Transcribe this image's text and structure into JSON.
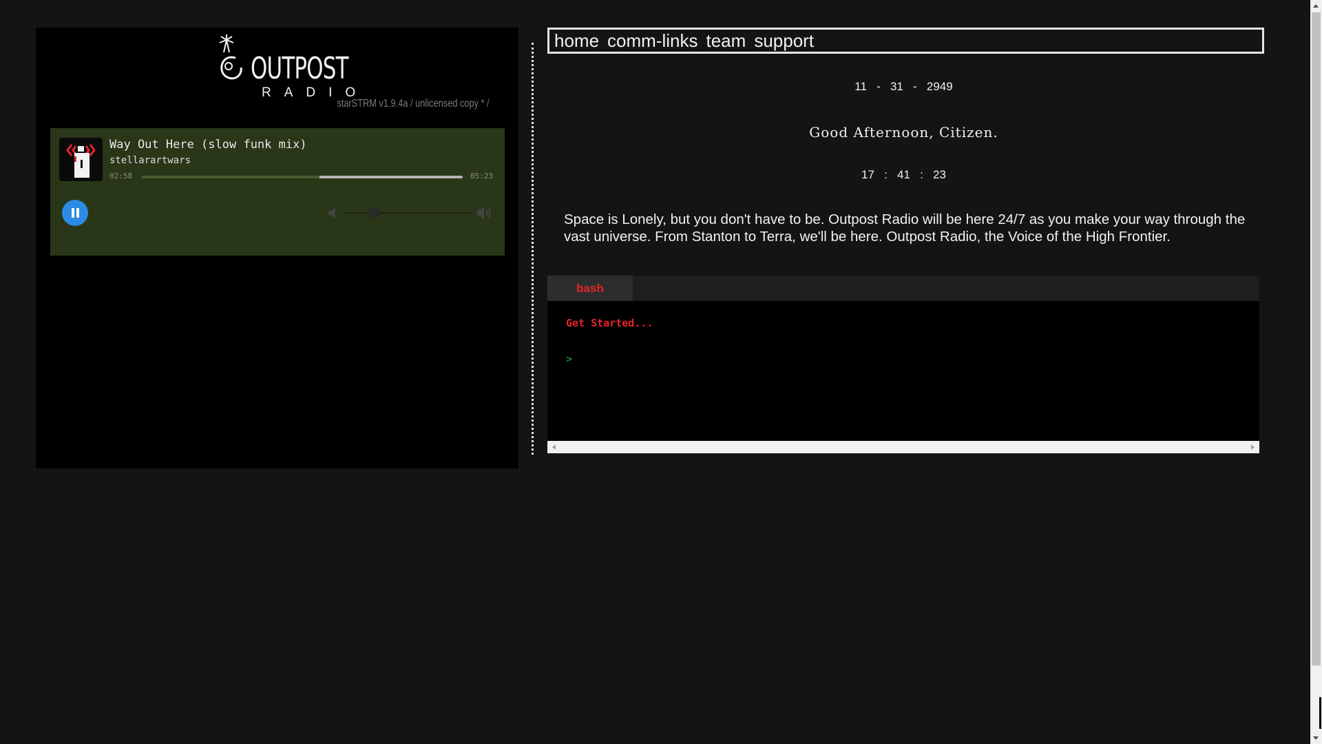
{
  "player": {
    "logo_word": "OUTPOST",
    "logo_sub": "RADIO",
    "version": "starSTRM v1.9.4a / unlicensed copy * /",
    "track_title": "Way Out Here (slow funk mix)",
    "artist": "stellarartwars",
    "time_elapsed": "02:58",
    "time_total": "05:23",
    "progress_fraction": 0.553,
    "volume_fraction": 0.23,
    "icons": {
      "album_art": "outpost-radio-tower-icon",
      "pause": "pause-icon",
      "volume_low": "volume-low-icon",
      "volume_high": "volume-high-icon"
    },
    "colors": {
      "panel_bg": "#000000",
      "player_bg": "#2a3618",
      "play_button": "#2d8be6"
    }
  },
  "nav": {
    "items": [
      "home",
      "comm-links",
      "team",
      "support"
    ]
  },
  "date": {
    "month": "11",
    "day": "31",
    "year": "2949",
    "separator": "-"
  },
  "greeting": "Good Afternoon, Citizen.",
  "clock": {
    "hours": "17",
    "minutes": "41",
    "seconds": "23",
    "separator": ":"
  },
  "intro": "Space is Lonely, but you don't have to be. Outpost Radio will be here 24/7 as you make your way through the vast universe. From Stanton to Terra, we'll be here. Outpost Radio, the Voice of the High Frontier.",
  "terminal": {
    "tab_label": "bash",
    "first_line": "Get Started...",
    "prompt": ">",
    "colors": {
      "tab_text": "#e8232a",
      "prompt": "#19b23a"
    }
  }
}
